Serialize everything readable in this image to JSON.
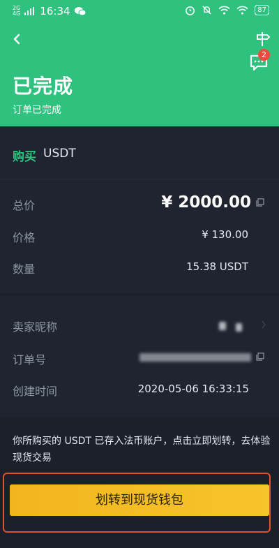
{
  "status_bar": {
    "net_top": "2G",
    "net_bottom": "4G",
    "time": "16:34",
    "battery": "87"
  },
  "header": {
    "title": "已完成",
    "subtitle": "订单已完成",
    "chat_badge": "2"
  },
  "order": {
    "side": "购买",
    "coin": "USDT",
    "total_label": "总价",
    "total_value": "¥ 2000.00",
    "price_label": "价格",
    "price_value": "¥ 130.00",
    "qty_label": "数量",
    "qty_value": "15.38 USDT"
  },
  "details": {
    "seller_label": "卖家昵称",
    "order_no_label": "订单号",
    "created_label": "创建时间",
    "created_value": "2020-05-06 16:33:15"
  },
  "notice": {
    "text": "你所购买的 USDT 已存入法币账户，点击立即划转，去体验现货交易"
  },
  "action": {
    "transfer_label": "划转到现货钱包"
  },
  "colors": {
    "brand_green": "#2ec27e",
    "button_yellow": "#f3b51e",
    "highlight_frame": "#e5512b"
  }
}
